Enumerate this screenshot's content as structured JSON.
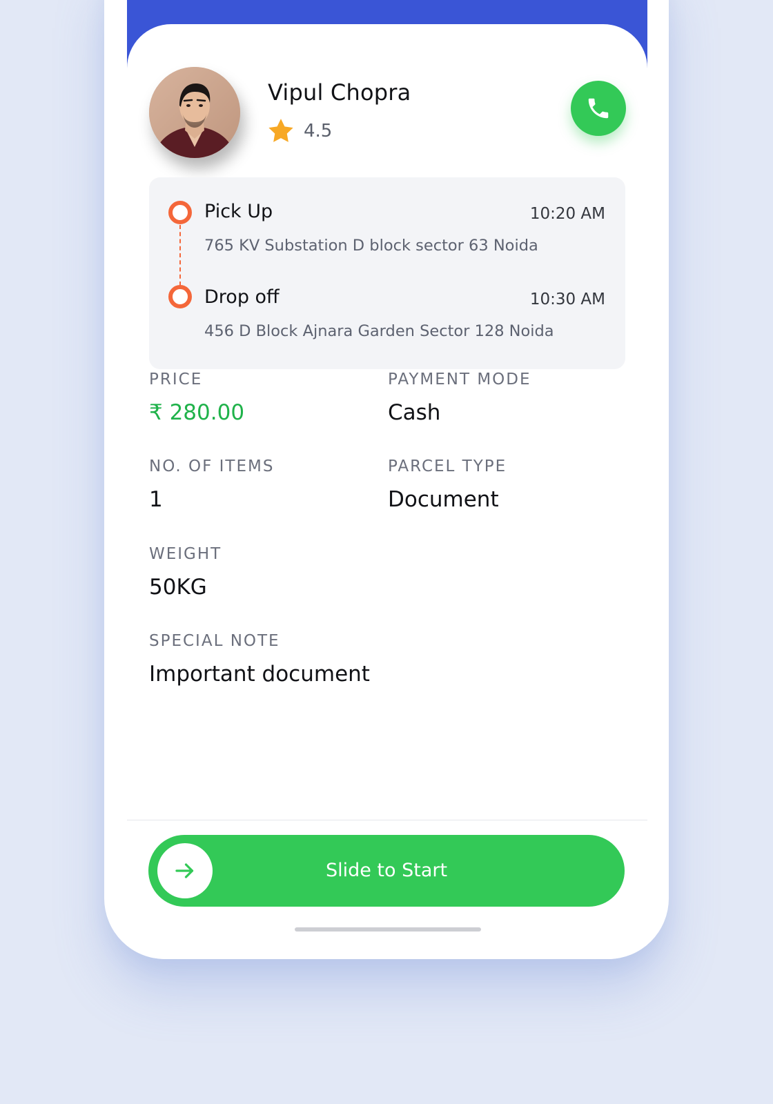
{
  "colors": {
    "background": "#e2e8f6",
    "header_blue": "#3a55d6",
    "accent_green": "#33c957",
    "price_green": "#1fb24a",
    "route_orange": "#f4673a",
    "star": "#f7a825"
  },
  "driver": {
    "name": "Vipul Chopra",
    "rating": "4.5",
    "avatar_icon": "avatar-photo",
    "star_icon": "star-icon",
    "call_icon": "phone-icon"
  },
  "route": {
    "pickup": {
      "title": "Pick Up",
      "time": "10:20 AM",
      "address": "765 KV Substation D block sector 63 Noida"
    },
    "dropoff": {
      "title": "Drop off",
      "time": "10:30 AM",
      "address": "456 D Block Ajnara Garden Sector 128 Noida"
    }
  },
  "details": {
    "price": {
      "label": "PRICE",
      "value": "₹ 280.00"
    },
    "payment_mode": {
      "label": "PAYMENT MODE",
      "value": "Cash"
    },
    "items": {
      "label": "NO. OF ITEMS",
      "value": "1"
    },
    "parcel_type": {
      "label": "PARCEL TYPE",
      "value": "Document"
    },
    "weight": {
      "label": "WEIGHT",
      "value": "50KG"
    },
    "special_note": {
      "label": "SPECIAL NOTE",
      "value": "Important document"
    }
  },
  "slider": {
    "label": "Slide to Start",
    "knob_icon": "arrow-right-icon"
  }
}
